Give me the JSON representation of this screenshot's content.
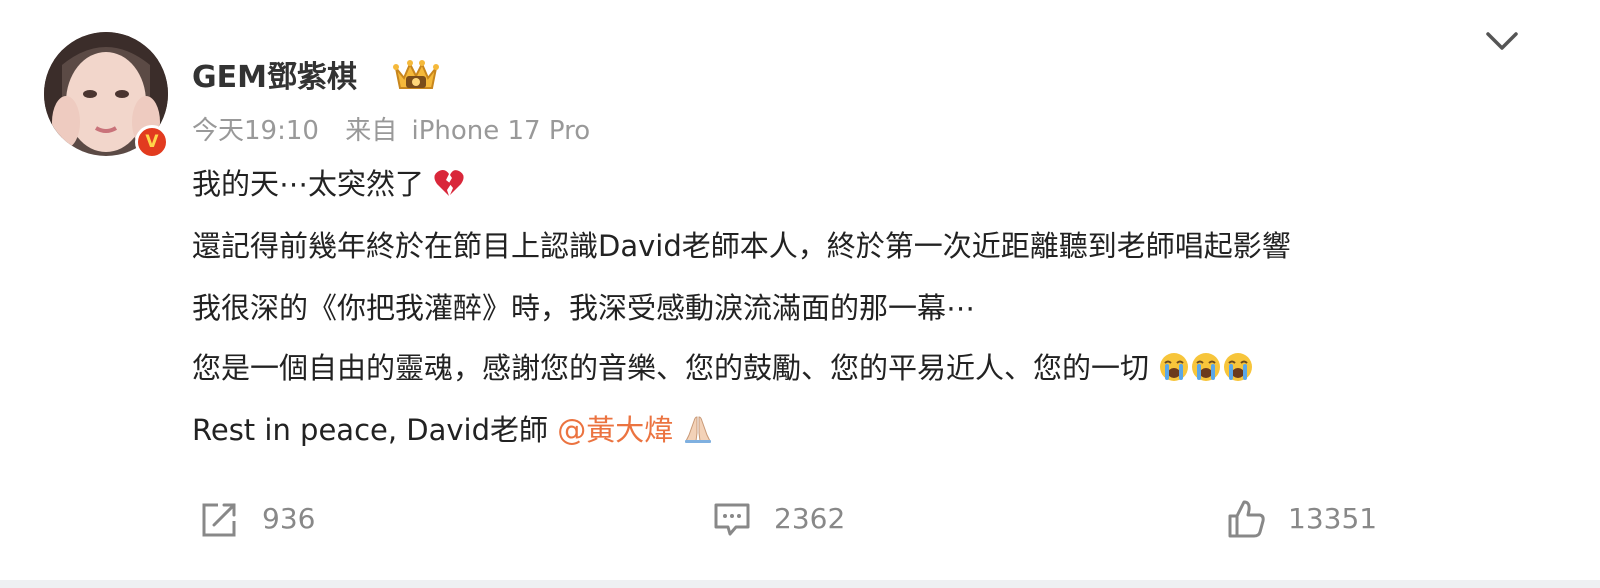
{
  "post": {
    "author": {
      "name": "GEM鄧紫棋",
      "verified_badge": "V"
    },
    "time": "今天19:10",
    "source_prefix": "来自",
    "source_device": "iPhone 17 Pro",
    "lines": {
      "l1": "我的天⋯太突然了",
      "l2": "還記得前幾年終於在節目上認識David老師本人，終於第一次近距離聽到老師唱起影響",
      "l3": "我很深的《你把我灌醉》時，我深受感動淚流滿面的那一幕⋯",
      "l4": "您是一個自由的靈魂，感謝您的音樂、您的鼓勵、您的平易近人、您的一切",
      "l5": "Rest in peace, David老師 "
    },
    "mention": "@黃大煒",
    "emojis": [
      "broken-heart",
      "loudly-crying-face",
      "loudly-crying-face",
      "loudly-crying-face",
      "folded-hands"
    ]
  },
  "actions": {
    "repost_count": "936",
    "comment_count": "2362",
    "like_count": "13351"
  },
  "icons": {
    "more": "chevron-down-icon",
    "repost": "share-out-icon",
    "comment": "comment-bubble-icon",
    "like": "thumb-up-icon",
    "member": "crown-icon"
  },
  "colors": {
    "mention": "#eb7340",
    "text": "#222222",
    "meta": "#999999",
    "verified": "#e23b1f"
  }
}
